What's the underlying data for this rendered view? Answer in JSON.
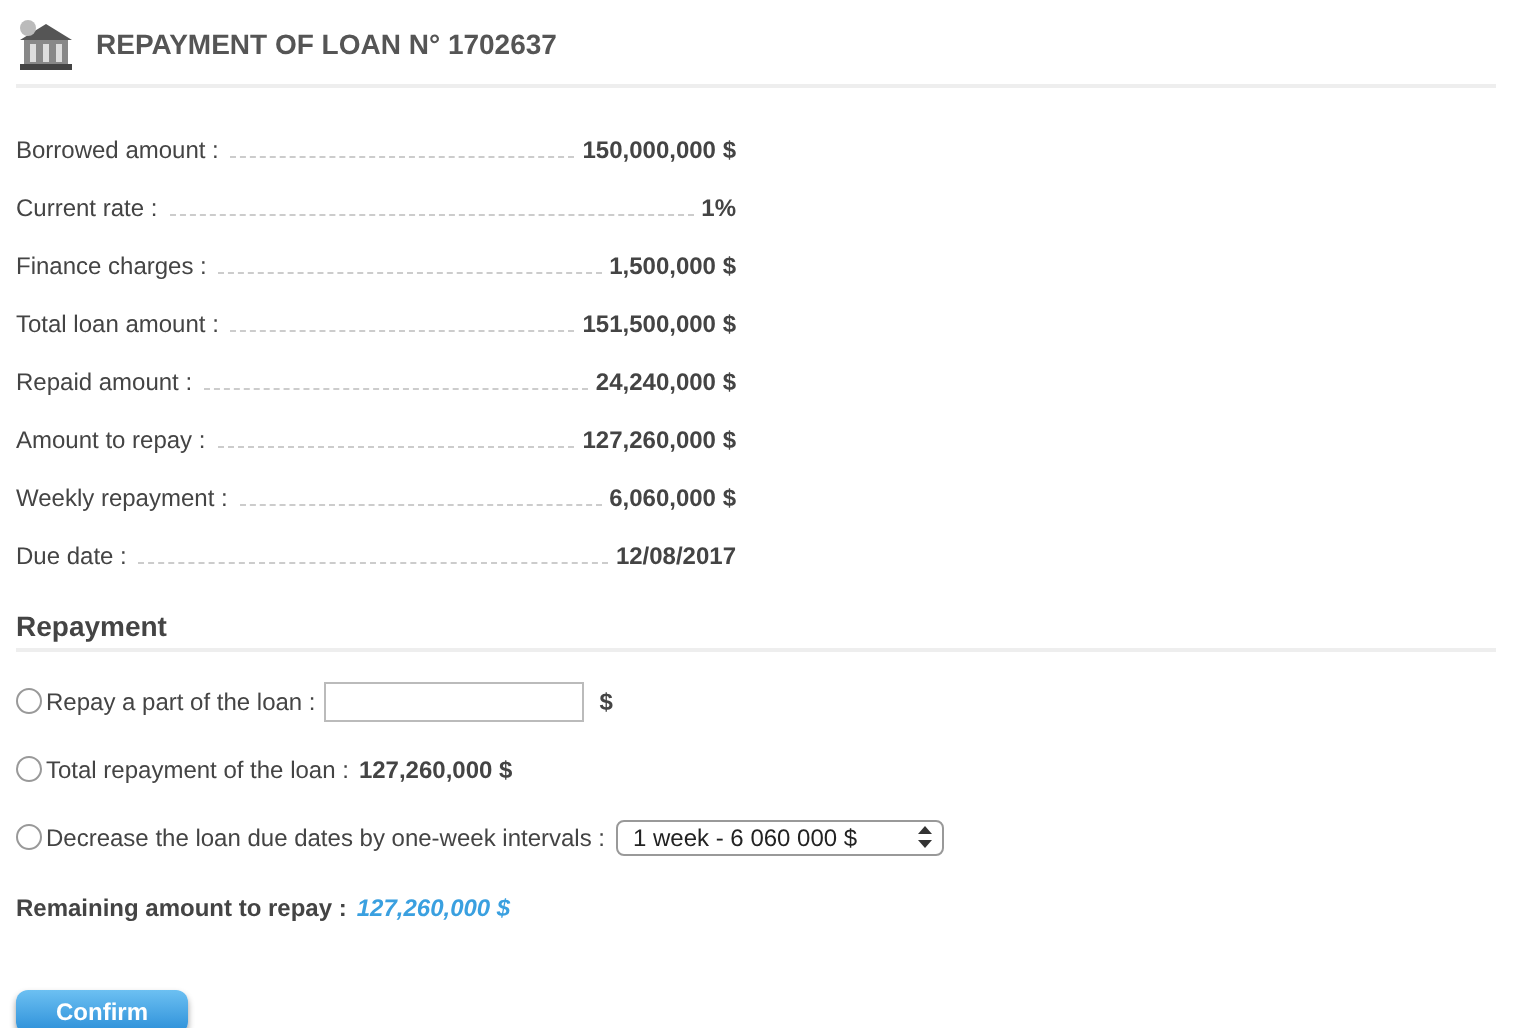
{
  "header": {
    "title": "REPAYMENT OF LOAN N° 1702637"
  },
  "details": [
    {
      "label": "Borrowed amount :",
      "value": "150,000,000 $"
    },
    {
      "label": "Current rate :",
      "value": "1%"
    },
    {
      "label": "Finance charges :",
      "value": "1,500,000 $"
    },
    {
      "label": "Total loan amount :",
      "value": "151,500,000 $"
    },
    {
      "label": "Repaid amount :",
      "value": "24,240,000 $"
    },
    {
      "label": "Amount to repay :",
      "value": "127,260,000 $"
    },
    {
      "label": "Weekly repayment :",
      "value": "6,060,000 $"
    },
    {
      "label": "Due date :",
      "value": "12/08/2017"
    }
  ],
  "repayment": {
    "heading": "Repayment",
    "options": [
      {
        "kind": "input",
        "label": "Repay a part of the loan :",
        "selected": false,
        "unit": "$"
      },
      {
        "kind": "total",
        "label": "Total repayment of the loan :",
        "selected": false,
        "amount": "127,260,000 $"
      },
      {
        "kind": "select",
        "label": "Decrease the loan due dates by one-week intervals :",
        "selected": false,
        "value": "1 week - 6 060 000 $"
      }
    ],
    "remaining_label": "Remaining amount to repay :",
    "remaining_value": "127,260,000 $"
  },
  "buttons": [
    "Confirm"
  ]
}
